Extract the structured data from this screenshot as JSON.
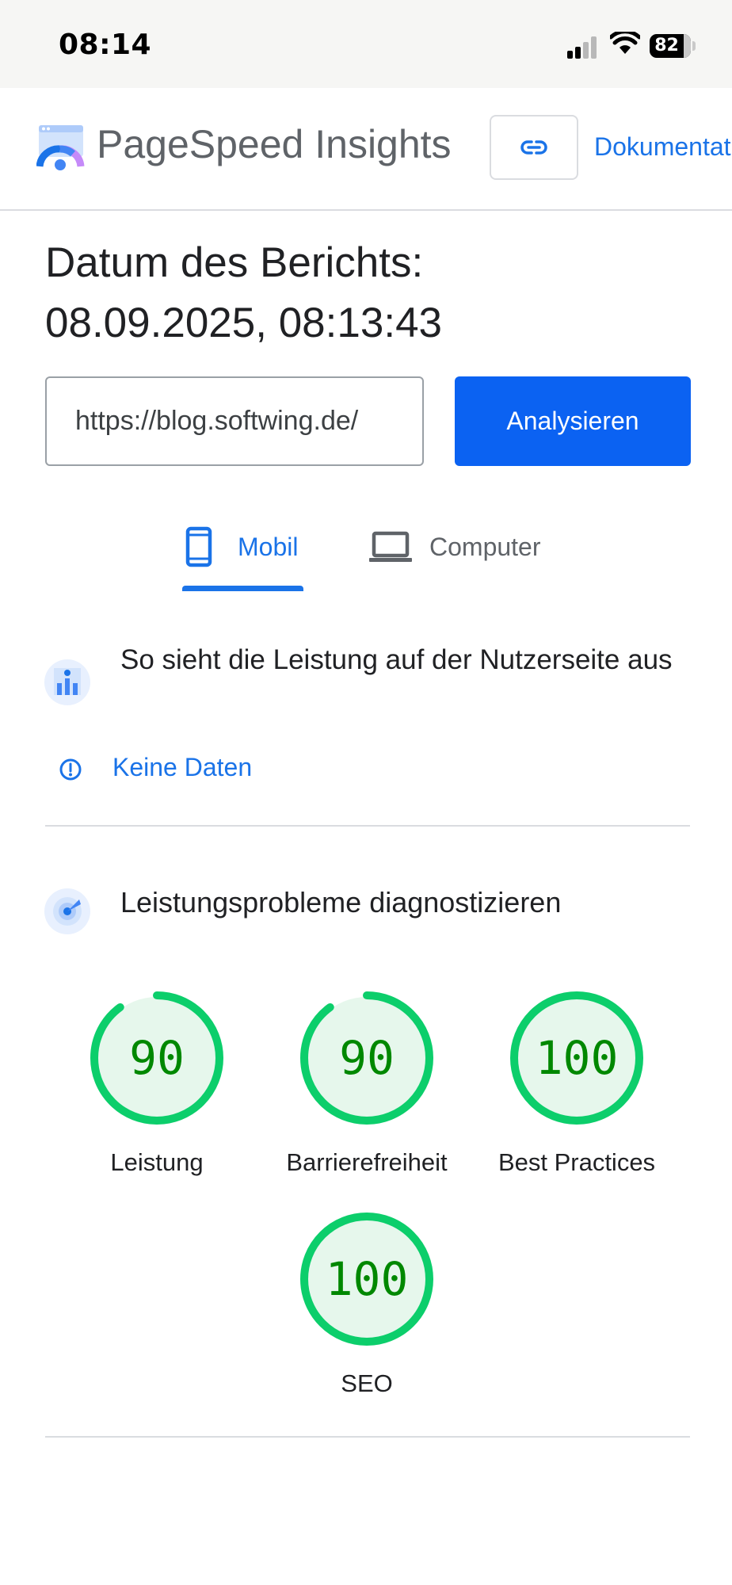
{
  "status_bar": {
    "time": "08:14",
    "battery": "82"
  },
  "header": {
    "title": "PageSpeed Insights",
    "docs_link": "Dokumentation"
  },
  "report": {
    "date_label": "Datum des Berichts:",
    "date_value": "08.09.2025, 08:13:43"
  },
  "form": {
    "url_value": "https://blog.softwing.de/",
    "analyze_label": "Analysieren"
  },
  "tabs": [
    {
      "label": "Mobil",
      "selected": true
    },
    {
      "label": "Computer",
      "selected": false
    }
  ],
  "field_data": {
    "title": "So sieht die Leistung auf der Nutzerseite aus",
    "no_data": "Keine Daten"
  },
  "diagnostics": {
    "title": "Leistungsprobleme diagnostizieren",
    "scores": [
      {
        "value": 90,
        "label": "Leistung"
      },
      {
        "value": 90,
        "label": "Barrierefreiheit"
      },
      {
        "value": 100,
        "label": "Best Practices"
      },
      {
        "value": 100,
        "label": "SEO"
      }
    ]
  },
  "colors": {
    "accent": "#1a73e8",
    "button": "#0b62f2",
    "gauge_pass": "#0cce6b",
    "gauge_text": "#008800",
    "gauge_fill": "#e6f7ec"
  }
}
